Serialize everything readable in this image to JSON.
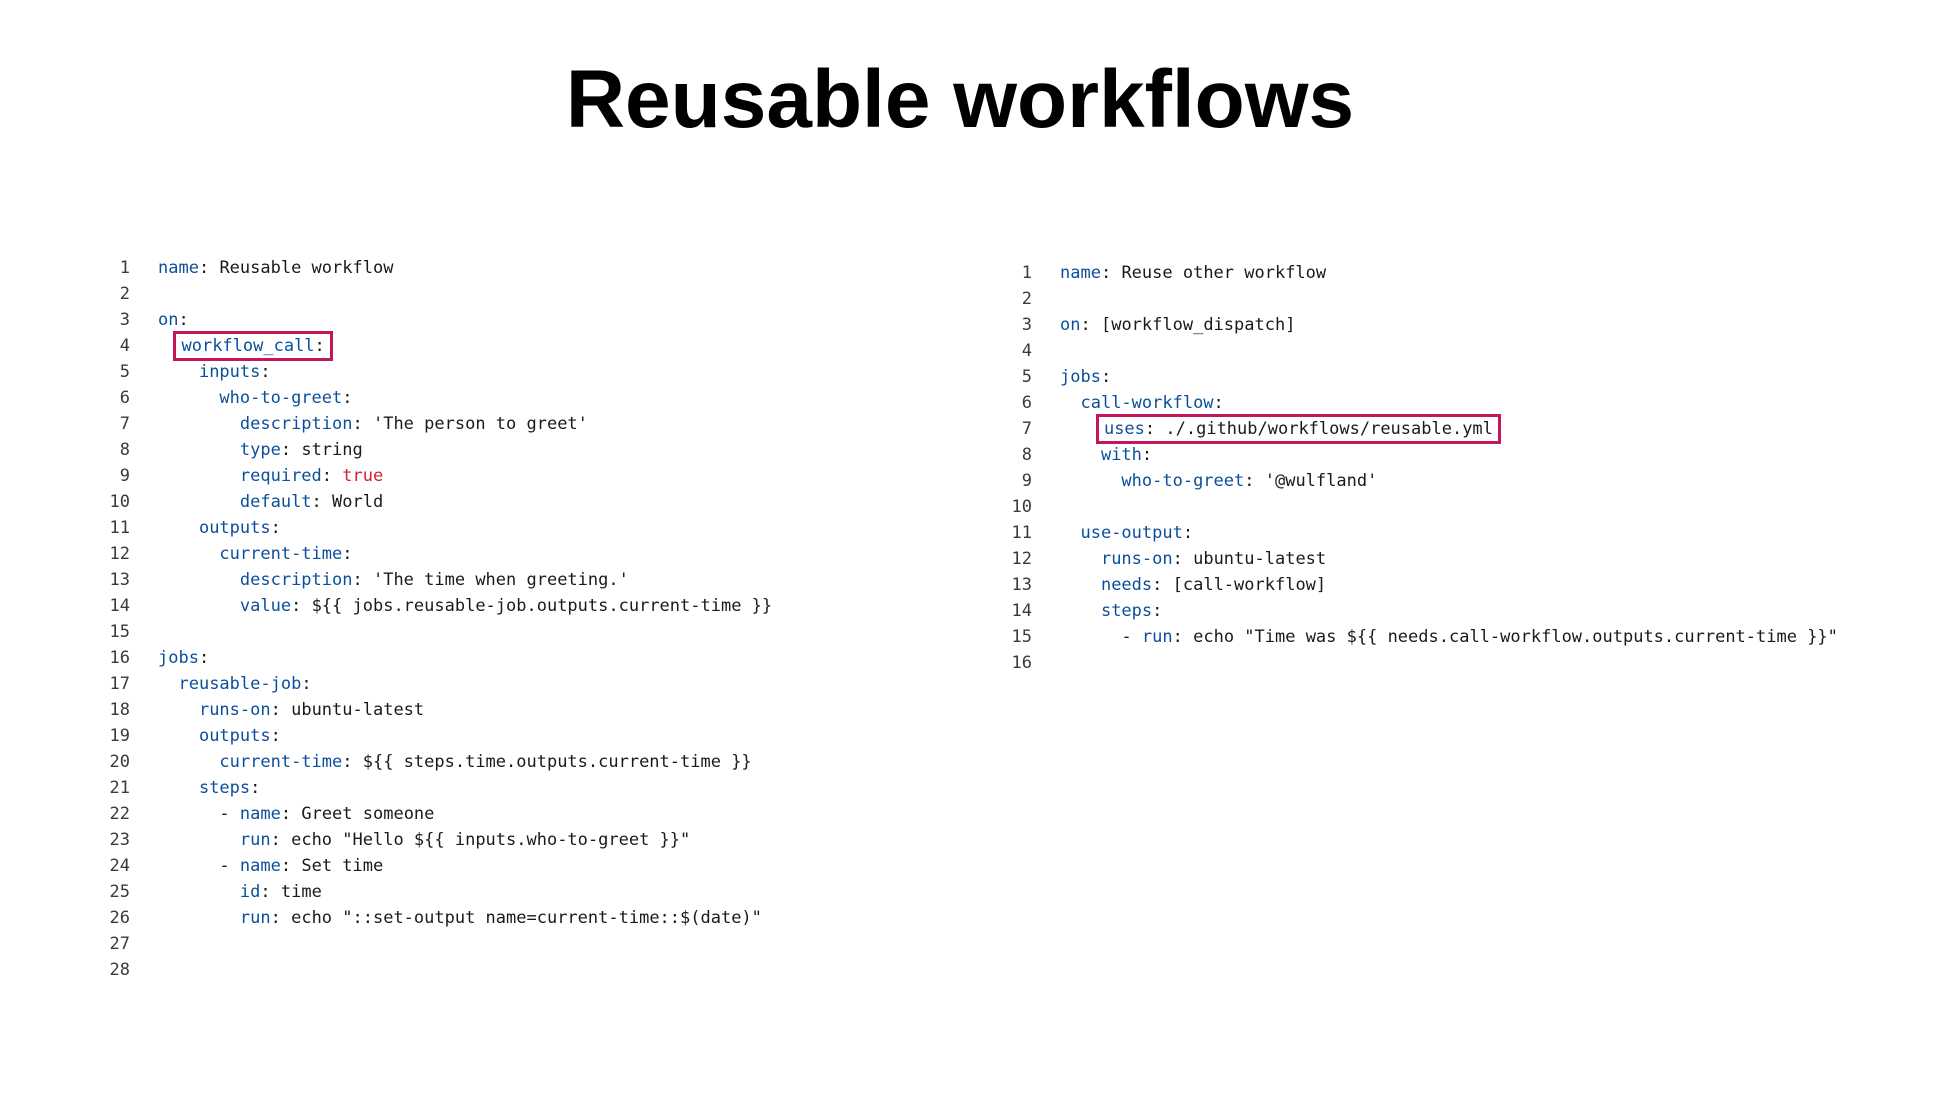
{
  "title": "Reusable workflows",
  "colors": {
    "key": "#0b4f9c",
    "value": "#1a1a1a",
    "boolean": "#cf222e",
    "highlight_border": "#c2185b"
  },
  "left_code": {
    "lines": [
      {
        "num": "1",
        "indent": "",
        "key": "name",
        "sep": ": ",
        "val": "Reusable workflow"
      },
      {
        "num": "2"
      },
      {
        "num": "3",
        "indent": "",
        "key": "on",
        "sep": ":"
      },
      {
        "num": "4",
        "indent": "  ",
        "key": "workflow_call",
        "sep": ":",
        "highlight": true
      },
      {
        "num": "5",
        "indent": "    ",
        "key": "inputs",
        "sep": ":"
      },
      {
        "num": "6",
        "indent": "      ",
        "key": "who-to-greet",
        "sep": ":"
      },
      {
        "num": "7",
        "indent": "        ",
        "key": "description",
        "sep": ": ",
        "val": "'The person to greet'"
      },
      {
        "num": "8",
        "indent": "        ",
        "key": "type",
        "sep": ": ",
        "val": "string"
      },
      {
        "num": "9",
        "indent": "        ",
        "key": "required",
        "sep": ": ",
        "val": "true",
        "val_type": "bool"
      },
      {
        "num": "10",
        "indent": "        ",
        "key": "default",
        "sep": ": ",
        "val": "World"
      },
      {
        "num": "11",
        "indent": "    ",
        "key": "outputs",
        "sep": ":"
      },
      {
        "num": "12",
        "indent": "      ",
        "key": "current-time",
        "sep": ":"
      },
      {
        "num": "13",
        "indent": "        ",
        "key": "description",
        "sep": ": ",
        "val": "'The time when greeting.'"
      },
      {
        "num": "14",
        "indent": "        ",
        "key": "value",
        "sep": ": ",
        "val": "${{ jobs.reusable-job.outputs.current-time }}"
      },
      {
        "num": "15"
      },
      {
        "num": "16",
        "indent": "",
        "key": "jobs",
        "sep": ":"
      },
      {
        "num": "17",
        "indent": "  ",
        "key": "reusable-job",
        "sep": ":"
      },
      {
        "num": "18",
        "indent": "    ",
        "key": "runs-on",
        "sep": ": ",
        "val": "ubuntu-latest"
      },
      {
        "num": "19",
        "indent": "    ",
        "key": "outputs",
        "sep": ":"
      },
      {
        "num": "20",
        "indent": "      ",
        "key": "current-time",
        "sep": ": ",
        "val": "${{ steps.time.outputs.current-time }}"
      },
      {
        "num": "21",
        "indent": "    ",
        "key": "steps",
        "sep": ":"
      },
      {
        "num": "22",
        "indent": "      ",
        "prefix": "- ",
        "key": "name",
        "sep": ": ",
        "val": "Greet someone"
      },
      {
        "num": "23",
        "indent": "        ",
        "key": "run",
        "sep": ": ",
        "val": "echo \"Hello ${{ inputs.who-to-greet }}\""
      },
      {
        "num": "24",
        "indent": "      ",
        "prefix": "- ",
        "key": "name",
        "sep": ": ",
        "val": "Set time"
      },
      {
        "num": "25",
        "indent": "        ",
        "key": "id",
        "sep": ": ",
        "val": "time"
      },
      {
        "num": "26",
        "indent": "        ",
        "key": "run",
        "sep": ": ",
        "val": "echo \"::set-output name=current-time::$(date)\""
      },
      {
        "num": "27"
      },
      {
        "num": "28"
      }
    ]
  },
  "right_code": {
    "lines": [
      {
        "num": "1",
        "indent": "",
        "key": "name",
        "sep": ": ",
        "val": "Reuse other workflow"
      },
      {
        "num": "2"
      },
      {
        "num": "3",
        "indent": "",
        "key": "on",
        "sep": ": ",
        "val": "[workflow_dispatch]"
      },
      {
        "num": "4"
      },
      {
        "num": "5",
        "indent": "",
        "key": "jobs",
        "sep": ":"
      },
      {
        "num": "6",
        "indent": "  ",
        "key": "call-workflow",
        "sep": ":"
      },
      {
        "num": "7",
        "indent": "    ",
        "key": "uses",
        "sep": ": ",
        "val": "./.github/workflows/reusable.yml",
        "highlight": true
      },
      {
        "num": "8",
        "indent": "    ",
        "key": "with",
        "sep": ":"
      },
      {
        "num": "9",
        "indent": "      ",
        "key": "who-to-greet",
        "sep": ": ",
        "val": "'@wulfland'"
      },
      {
        "num": "10"
      },
      {
        "num": "11",
        "indent": "  ",
        "key": "use-output",
        "sep": ":"
      },
      {
        "num": "12",
        "indent": "    ",
        "key": "runs-on",
        "sep": ": ",
        "val": "ubuntu-latest"
      },
      {
        "num": "13",
        "indent": "    ",
        "key": "needs",
        "sep": ": ",
        "val": "[call-workflow]"
      },
      {
        "num": "14",
        "indent": "    ",
        "key": "steps",
        "sep": ":"
      },
      {
        "num": "15",
        "indent": "      ",
        "prefix": "- ",
        "key": "run",
        "sep": ": ",
        "val": "echo \"Time was ${{ needs.call-workflow.outputs.current-time }}\""
      },
      {
        "num": "16"
      }
    ]
  }
}
